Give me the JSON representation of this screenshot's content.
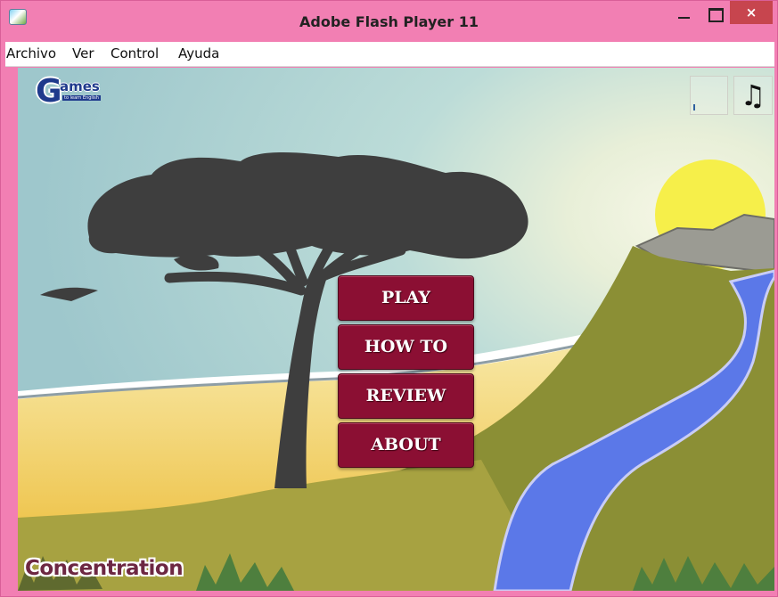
{
  "window": {
    "title": "Adobe Flash Player 11",
    "close_glyph": "×"
  },
  "menubar": {
    "items": [
      "Archivo",
      "Ver",
      "Control",
      "Ayuda"
    ]
  },
  "game": {
    "logo": {
      "letter": "G",
      "word": "ames",
      "tagline": "to learn English"
    },
    "music_icon": "♫",
    "volume_level": 0.2,
    "buttons": {
      "play": "PLAY",
      "how_to": "HOW TO",
      "review": "REVIEW",
      "about": "ABOUT"
    },
    "game_title": "Concentration"
  },
  "colors": {
    "window_frame": "#f27fb3",
    "button": "#8b0f33",
    "sky": "#a6cfd2",
    "sun": "#f6ef4a",
    "river": "#5b78e8",
    "hills": "#8a8f34",
    "sand": "#f2cc53",
    "tree": "#3e3e3e"
  }
}
